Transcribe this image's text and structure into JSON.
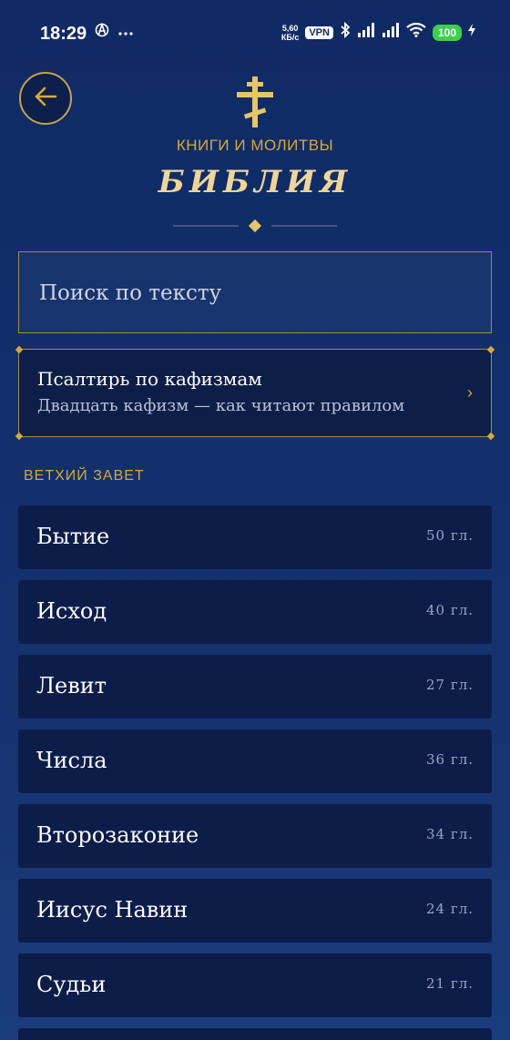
{
  "status_bar": {
    "time": "18:29",
    "speed_value": "5,60",
    "speed_unit": "КБ/с",
    "vpn_label": "VPN",
    "battery": "100"
  },
  "header": {
    "subtitle": "КНИГИ И МОЛИТВЫ",
    "title": "БИБЛИЯ"
  },
  "search": {
    "placeholder": "Поиск по тексту"
  },
  "psalter": {
    "title": "Псалтирь по кафизмам",
    "subtitle": "Двадцать кафизм — как читают правилом",
    "chevron": "›"
  },
  "section": {
    "label": "ВЕТХИЙ ЗАВЕТ"
  },
  "books": [
    {
      "name": "Бытие",
      "chapters": "50 гл."
    },
    {
      "name": "Исход",
      "chapters": "40 гл."
    },
    {
      "name": "Левит",
      "chapters": "27 гл."
    },
    {
      "name": "Числа",
      "chapters": "36 гл."
    },
    {
      "name": "Второзаконие",
      "chapters": "34 гл."
    },
    {
      "name": "Иисус Навин",
      "chapters": "24 гл."
    },
    {
      "name": "Судьи",
      "chapters": "21 гл."
    },
    {
      "name": "",
      "chapters": ""
    }
  ],
  "colors": {
    "accent_gold": "#d8a93a",
    "background": "#122f6b",
    "row_background": "#0c1d4a"
  }
}
